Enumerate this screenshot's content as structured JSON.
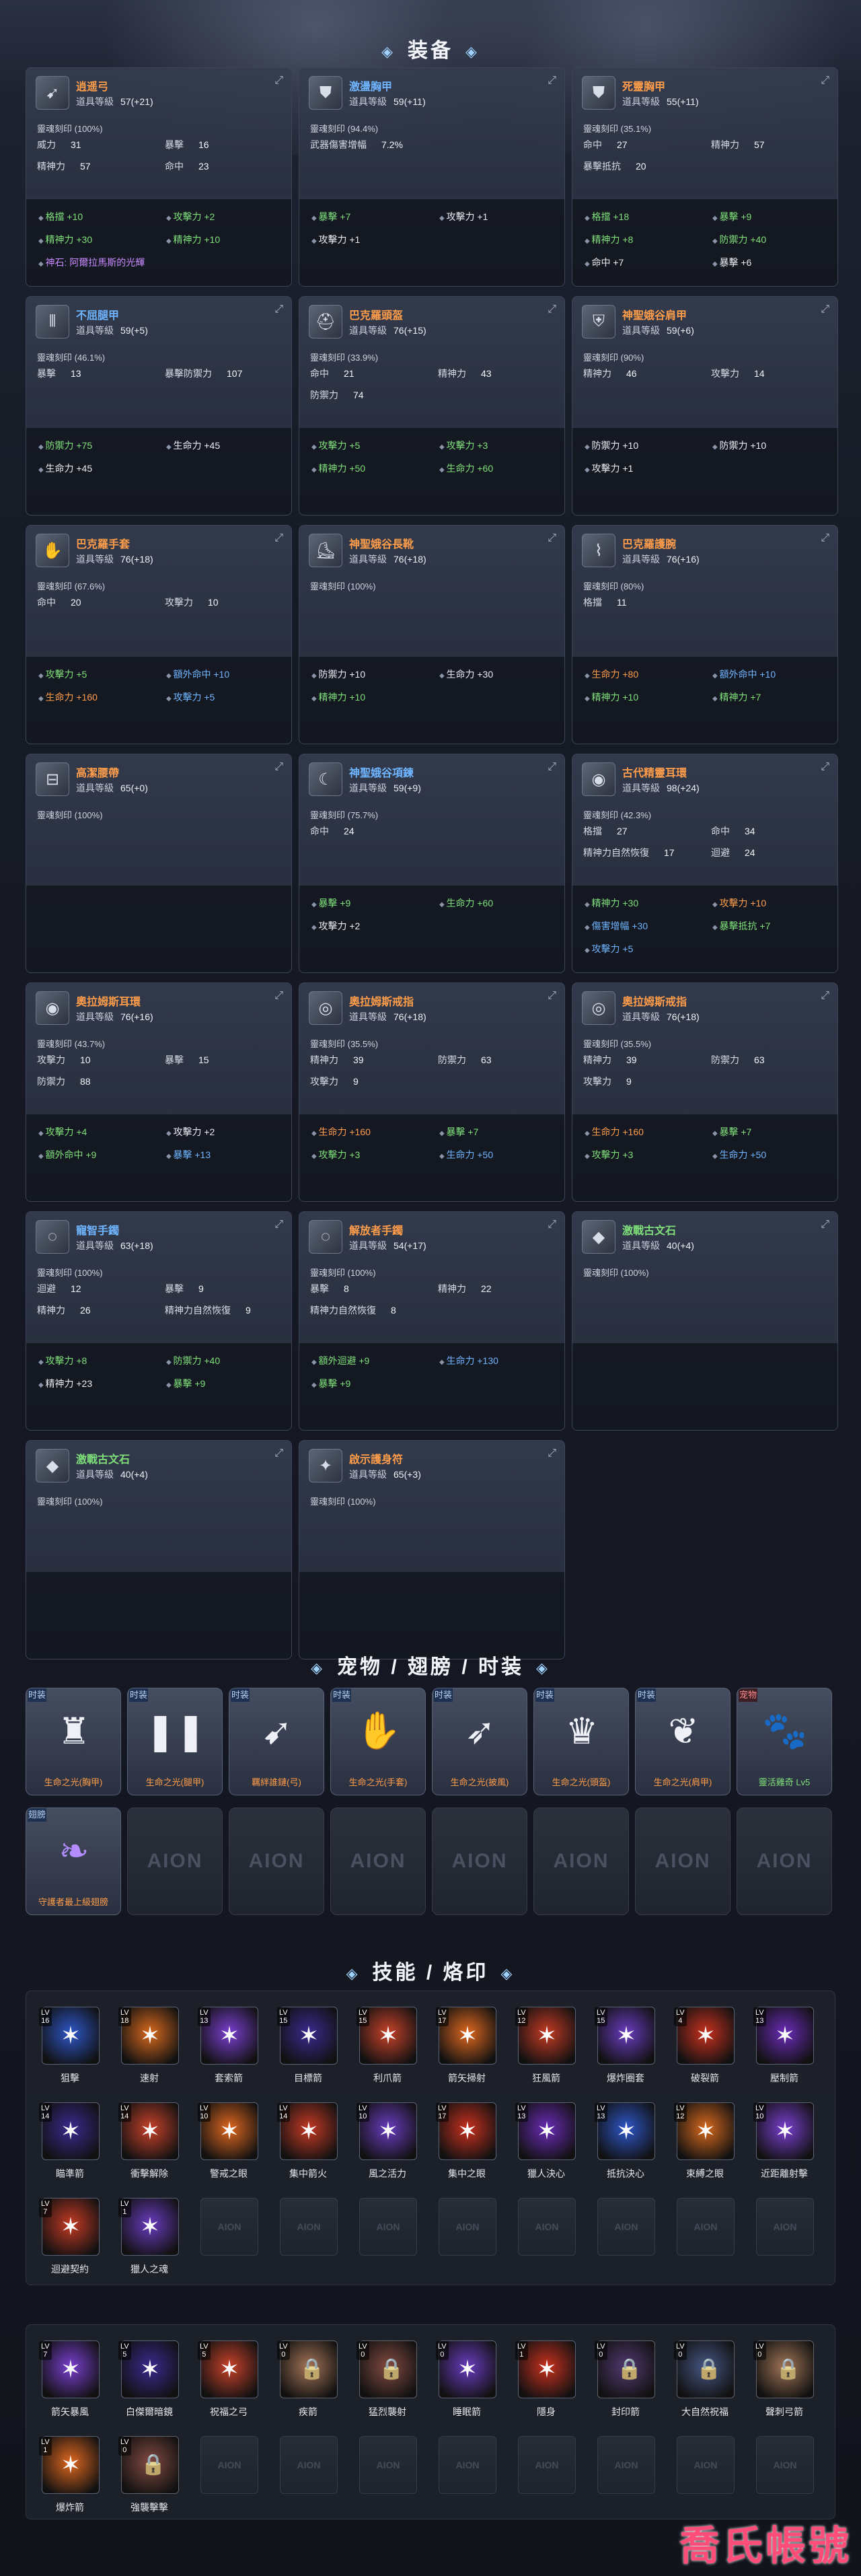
{
  "sections": {
    "equip": "装备",
    "pets": "宠物 / 翅膀 / 时装",
    "skills": "技能 / 烙印"
  },
  "equipment": [
    {
      "name": "逍遥弓",
      "color": "orange",
      "icon": "bow-icon",
      "level": "57(+21)",
      "soul": "靈魂刻印 (100%)",
      "stats": [
        [
          "威力",
          "31"
        ],
        [
          "暴擊",
          "16"
        ],
        [
          "精神力",
          "57"
        ],
        [
          "命中",
          "23"
        ]
      ],
      "bonus": [
        [
          "格擋 +10",
          "green"
        ],
        [
          "攻擊力 +2",
          "green"
        ],
        [
          "精神力 +30",
          "green"
        ],
        [
          "精神力 +10",
          "green"
        ]
      ],
      "note": "神石: 阿爾拉馬斯的光輝"
    },
    {
      "name": "激盪胸甲",
      "color": "blue",
      "icon": "armor-icon",
      "level": "59(+11)",
      "soul": "靈魂刻印 (94.4%)",
      "stats": [
        [
          "武器傷害增幅",
          "7.2%"
        ]
      ],
      "bonus": [
        [
          "暴擊 +7",
          "green"
        ],
        [
          "攻擊力 +1",
          "white"
        ],
        [
          "攻擊力 +1",
          "white"
        ]
      ]
    },
    {
      "name": "死靈胸甲",
      "color": "orange",
      "icon": "armor-icon",
      "level": "55(+11)",
      "soul": "靈魂刻印 (35.1%)",
      "stats": [
        [
          "命中",
          "27"
        ],
        [
          "精神力",
          "57"
        ],
        [
          "暴擊抵抗",
          "20"
        ]
      ],
      "bonus": [
        [
          "格擋 +18",
          "green"
        ],
        [
          "暴擊 +9",
          "green"
        ],
        [
          "精神力 +8",
          "green"
        ],
        [
          "防禦力 +40",
          "green"
        ],
        [
          "命中 +7",
          "white"
        ],
        [
          "暴擊 +6",
          "white"
        ]
      ]
    },
    {
      "name": "不屈腿甲",
      "color": "blue",
      "icon": "legs-icon",
      "level": "59(+5)",
      "soul": "靈魂刻印 (46.1%)",
      "stats": [
        [
          "暴擊",
          "13"
        ],
        [
          "暴擊防禦力",
          "107"
        ]
      ],
      "bonus": [
        [
          "防禦力 +75",
          "green"
        ],
        [
          "生命力 +45",
          "white"
        ],
        [
          "生命力 +45",
          "white"
        ]
      ]
    },
    {
      "name": "巴克羅頭盔",
      "color": "orange",
      "icon": "helmet-icon",
      "level": "76(+15)",
      "soul": "靈魂刻印 (33.9%)",
      "stats": [
        [
          "命中",
          "21"
        ],
        [
          "精神力",
          "43"
        ],
        [
          "防禦力",
          "74"
        ]
      ],
      "bonus": [
        [
          "攻擊力 +5",
          "green"
        ],
        [
          "攻擊力 +3",
          "green"
        ],
        [
          "精神力 +50",
          "green"
        ],
        [
          "生命力 +60",
          "green"
        ]
      ]
    },
    {
      "name": "神聖娥谷肩甲",
      "color": "orange",
      "icon": "shoulder-icon",
      "level": "59(+6)",
      "soul": "靈魂刻印 (90%)",
      "stats": [
        [
          "精神力",
          "46"
        ],
        [
          "攻擊力",
          "14"
        ]
      ],
      "bonus": [
        [
          "防禦力 +10",
          "white"
        ],
        [
          "防禦力 +10",
          "white"
        ],
        [
          "攻擊力 +1",
          "white"
        ]
      ]
    },
    {
      "name": "巴克羅手套",
      "color": "orange",
      "icon": "glove-icon",
      "level": "76(+18)",
      "soul": "靈魂刻印 (67.6%)",
      "stats": [
        [
          "命中",
          "20"
        ],
        [
          "攻擊力",
          "10"
        ]
      ],
      "bonus": [
        [
          "攻擊力 +5",
          "green"
        ],
        [
          "額外命中 +10",
          "blue"
        ],
        [
          "生命力 +160",
          "orange"
        ],
        [
          "攻擊力 +5",
          "blue"
        ]
      ]
    },
    {
      "name": "神聖娥谷長靴",
      "color": "orange",
      "icon": "boots-icon",
      "level": "76(+18)",
      "soul": "靈魂刻印 (100%)",
      "stats": [],
      "bonus": [
        [
          "防禦力 +10",
          "white"
        ],
        [
          "生命力 +30",
          "white"
        ],
        [
          "精神力 +10",
          "green"
        ]
      ]
    },
    {
      "name": "巴克羅護腕",
      "color": "orange",
      "icon": "bracer-icon",
      "level": "76(+16)",
      "soul": "靈魂刻印 (80%)",
      "stats": [
        [
          "格擋",
          "11"
        ]
      ],
      "bonus": [
        [
          "生命力 +80",
          "orange"
        ],
        [
          "額外命中 +10",
          "blue"
        ],
        [
          "精神力 +10",
          "green"
        ],
        [
          "精神力 +7",
          "green"
        ]
      ]
    },
    {
      "name": "高潔腰帶",
      "color": "orange",
      "icon": "belt-icon",
      "level": "65(+0)",
      "soul": "靈魂刻印 (100%)",
      "stats": [],
      "bonus": []
    },
    {
      "name": "神聖娥谷項鍊",
      "color": "blue",
      "icon": "necklace-icon",
      "level": "59(+9)",
      "soul": "靈魂刻印 (75.7%)",
      "stats": [
        [
          "命中",
          "24"
        ]
      ],
      "bonus": [
        [
          "暴擊 +9",
          "green"
        ],
        [
          "生命力 +60",
          "green"
        ],
        [
          "攻擊力 +2",
          "white"
        ]
      ]
    },
    {
      "name": "古代精靈耳環",
      "color": "orange",
      "icon": "earring-icon",
      "level": "98(+24)",
      "soul": "靈魂刻印 (42.3%)",
      "stats": [
        [
          "格擋",
          "27"
        ],
        [
          "命中",
          "34"
        ],
        [
          "精神力自然恢復",
          "17"
        ],
        [
          "迴避",
          "24"
        ]
      ],
      "bonus": [
        [
          "精神力 +30",
          "green"
        ],
        [
          "攻擊力 +10",
          "orange"
        ],
        [
          "傷害增幅 +30",
          "blue"
        ],
        [
          "暴擊抵抗 +7",
          "green"
        ],
        [
          "攻擊力 +5",
          "blue"
        ]
      ]
    },
    {
      "name": "奧拉姆斯耳環",
      "color": "orange",
      "icon": "earring-icon",
      "level": "76(+16)",
      "soul": "靈魂刻印 (43.7%)",
      "stats": [
        [
          "攻擊力",
          "10"
        ],
        [
          "暴擊",
          "15"
        ],
        [
          "防禦力",
          "88"
        ]
      ],
      "bonus": [
        [
          "攻擊力 +4",
          "green"
        ],
        [
          "攻擊力 +2",
          "white"
        ],
        [
          "額外命中 +9",
          "green"
        ],
        [
          "暴擊 +13",
          "blue"
        ]
      ]
    },
    {
      "name": "奧拉姆斯戒指",
      "color": "orange",
      "icon": "ring-icon",
      "level": "76(+18)",
      "soul": "靈魂刻印 (35.5%)",
      "stats": [
        [
          "精神力",
          "39"
        ],
        [
          "防禦力",
          "63"
        ],
        [
          "攻擊力",
          "9"
        ]
      ],
      "bonus": [
        [
          "生命力 +160",
          "orange"
        ],
        [
          "暴擊 +7",
          "green"
        ],
        [
          "攻擊力 +3",
          "green"
        ],
        [
          "生命力 +50",
          "blue"
        ]
      ]
    },
    {
      "name": "奧拉姆斯戒指",
      "color": "orange",
      "icon": "ring-icon",
      "level": "76(+18)",
      "soul": "靈魂刻印 (35.5%)",
      "stats": [
        [
          "精神力",
          "39"
        ],
        [
          "防禦力",
          "63"
        ],
        [
          "攻擊力",
          "9"
        ]
      ],
      "bonus": [
        [
          "生命力 +160",
          "orange"
        ],
        [
          "暴擊 +7",
          "green"
        ],
        [
          "攻擊力 +3",
          "green"
        ],
        [
          "生命力 +50",
          "blue"
        ]
      ]
    },
    {
      "name": "寵智手鐲",
      "color": "blue",
      "icon": "bracelet-icon",
      "level": "63(+18)",
      "soul": "靈魂刻印 (100%)",
      "stats": [
        [
          "迴避",
          "12"
        ],
        [
          "暴擊",
          "9"
        ],
        [
          "精神力",
          "26"
        ],
        [
          "精神力自然恢復",
          "9"
        ]
      ],
      "bonus": [
        [
          "攻擊力 +8",
          "green"
        ],
        [
          "防禦力 +40",
          "green"
        ],
        [
          "精神力 +23",
          "white"
        ],
        [
          "暴擊 +9",
          "green"
        ]
      ]
    },
    {
      "name": "解放者手鐲",
      "color": "orange",
      "icon": "bracelet-icon",
      "level": "54(+17)",
      "soul": "靈魂刻印 (100%)",
      "stats": [
        [
          "暴擊",
          "8"
        ],
        [
          "精神力",
          "22"
        ],
        [
          "精神力自然恢復",
          "8"
        ]
      ],
      "bonus": [
        [
          "額外迴避 +9",
          "green"
        ],
        [
          "生命力 +130",
          "blue"
        ],
        [
          "暴擊 +9",
          "green"
        ]
      ]
    },
    {
      "name": "激戰古文石",
      "color": "green",
      "icon": "stone-icon",
      "level": "40(+4)",
      "soul": "靈魂刻印 (100%)",
      "stats": [],
      "bonus": []
    },
    {
      "name": "激戰古文石",
      "color": "green",
      "icon": "stone-icon",
      "level": "40(+4)",
      "soul": "靈魂刻印 (100%)",
      "stats": [],
      "bonus": []
    },
    {
      "name": "啟示護身符",
      "color": "orange",
      "icon": "amulet-icon",
      "level": "65(+3)",
      "soul": "靈魂刻印 (100%)",
      "stats": [],
      "bonus": []
    }
  ],
  "level_label": "道具等級",
  "pets": [
    {
      "label": "生命之光(胸甲)",
      "tag": "时装",
      "glyph": "♜"
    },
    {
      "label": "生命之光(腿甲)",
      "tag": "时装",
      "glyph": "❚❚"
    },
    {
      "label": "羈絆誰鏈(弓)",
      "tag": "时装",
      "glyph": "➹"
    },
    {
      "label": "生命之光(手套)",
      "tag": "时装",
      "glyph": "✋"
    },
    {
      "label": "生命之光(披風)",
      "tag": "时装",
      "glyph": "➶"
    },
    {
      "label": "生命之光(頭盔)",
      "tag": "时装",
      "glyph": "♛"
    },
    {
      "label": "生命之光(肩甲)",
      "tag": "时装",
      "glyph": "❦"
    },
    {
      "label": "靈活雞奇 Lv5",
      "tag": "宠物",
      "glyph": "🐾",
      "green": true,
      "red": true
    }
  ],
  "wing": {
    "label": "守護者最上級翅膀",
    "tag": "翅膀",
    "glyph": "❧"
  },
  "empty_label": "AION",
  "skills_row1": [
    {
      "name": "狙擊",
      "lv": "16"
    },
    {
      "name": "速射",
      "lv": "18"
    },
    {
      "name": "套索箭",
      "lv": "13"
    },
    {
      "name": "目標箭",
      "lv": "15"
    },
    {
      "name": "利爪箭",
      "lv": "15"
    },
    {
      "name": "箭矢掃射",
      "lv": "17"
    },
    {
      "name": "狂風箭",
      "lv": "12"
    },
    {
      "name": "爆炸圈套",
      "lv": "15"
    },
    {
      "name": "破裂箭",
      "lv": "4"
    },
    {
      "name": "壓制箭",
      "lv": "13"
    }
  ],
  "skills_row2": [
    {
      "name": "瞄準箭",
      "lv": "14"
    },
    {
      "name": "衝擊解除",
      "lv": "14"
    },
    {
      "name": "警戒之眼",
      "lv": "10"
    },
    {
      "name": "集中箭火",
      "lv": "14"
    },
    {
      "name": "風之活力",
      "lv": "10"
    },
    {
      "name": "集中之眼",
      "lv": "17"
    },
    {
      "name": "獵人決心",
      "lv": "13"
    },
    {
      "name": "抵抗決心",
      "lv": "13"
    },
    {
      "name": "束縛之眼",
      "lv": "12"
    },
    {
      "name": "近距離射擊",
      "lv": "10"
    }
  ],
  "skills_row3": [
    {
      "name": "迴避契約",
      "lv": "7"
    },
    {
      "name": "獵人之魂",
      "lv": "1"
    }
  ],
  "skills_row4": [
    {
      "name": "箭矢暴風",
      "lv": "7",
      "locked": false
    },
    {
      "name": "白傑爾暗鏡",
      "lv": "5",
      "locked": false
    },
    {
      "name": "祝福之弓",
      "lv": "5",
      "locked": false
    },
    {
      "name": "疾箭",
      "lv": "0",
      "locked": true
    },
    {
      "name": "猛烈襲射",
      "lv": "0",
      "locked": true
    },
    {
      "name": "睡眠箭",
      "lv": "0",
      "locked": false
    },
    {
      "name": "隱身",
      "lv": "1",
      "locked": false
    },
    {
      "name": "封印箭",
      "lv": "0",
      "locked": true
    },
    {
      "name": "大自然祝福",
      "lv": "0",
      "locked": true
    },
    {
      "name": "聲刺弓箭",
      "lv": "0",
      "locked": true
    }
  ],
  "skills_row5": [
    {
      "name": "爆炸箭",
      "lv": "1",
      "locked": false
    },
    {
      "name": "強襲擊擊",
      "lv": "0",
      "locked": true
    }
  ],
  "watermark": "喬氏帳號"
}
